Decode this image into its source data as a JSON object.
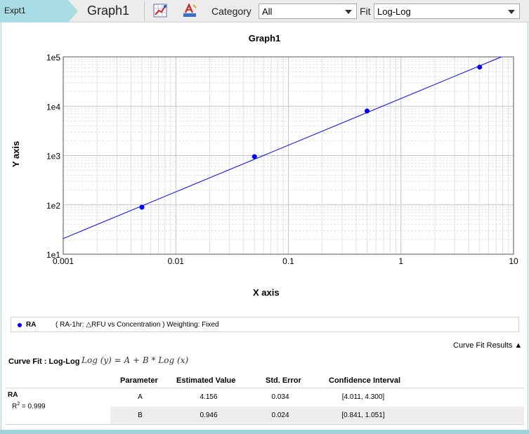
{
  "toolbar": {
    "experiment_tab": "Expt1",
    "graph_tab": "Graph1",
    "category_label": "Category",
    "category_value": "All",
    "fit_label": "Fit",
    "fit_value": "Log-Log",
    "icons": [
      "graph-settings-icon",
      "chart-style-icon"
    ]
  },
  "chart_data": {
    "type": "scatter",
    "title": "Graph1",
    "xlabel": "X axis",
    "ylabel": "Y axis",
    "x_scale": "log",
    "y_scale": "log",
    "xlim": [
      0.001,
      10
    ],
    "ylim": [
      10,
      100000
    ],
    "x_ticks": [
      0.001,
      0.01,
      0.1,
      1,
      10
    ],
    "x_tick_labels": [
      "0.001",
      "0.01",
      "0.1",
      "1",
      "10"
    ],
    "y_ticks": [
      10,
      100,
      1000,
      10000,
      100000
    ],
    "y_tick_labels": [
      "1e1",
      "1e2",
      "1e3",
      "1e4",
      "1e5"
    ],
    "grid": true,
    "series": [
      {
        "name": "RA",
        "color": "#0000ff",
        "x": [
          0.005,
          0.05,
          0.5,
          5
        ],
        "y": [
          90,
          950,
          8000,
          62000
        ]
      }
    ],
    "fit_line": {
      "A": 4.156,
      "B": 0.946,
      "color": "#0000ff"
    }
  },
  "legend": {
    "name": "RA",
    "description": "( RA-1hr: △RFU vs Concentration )  Weighting: Fixed"
  },
  "results": {
    "toggle_label": "Curve Fit Results ▲",
    "curve_fit_label": "Curve Fit : Log-Log",
    "equation": "Log (y) = A + B * Log (x)",
    "columns": [
      "Parameter",
      "Estimated Value",
      "Std. Error",
      "Confidence Interval"
    ],
    "series_name": "RA",
    "r2_prefix": "R",
    "r2_value": " = 0.999",
    "rows": [
      [
        "A",
        "4.156",
        "0.034",
        "[4.011, 4.300]"
      ],
      [
        "B",
        "0.946",
        "0.024",
        "[0.841, 1.051]"
      ]
    ]
  }
}
